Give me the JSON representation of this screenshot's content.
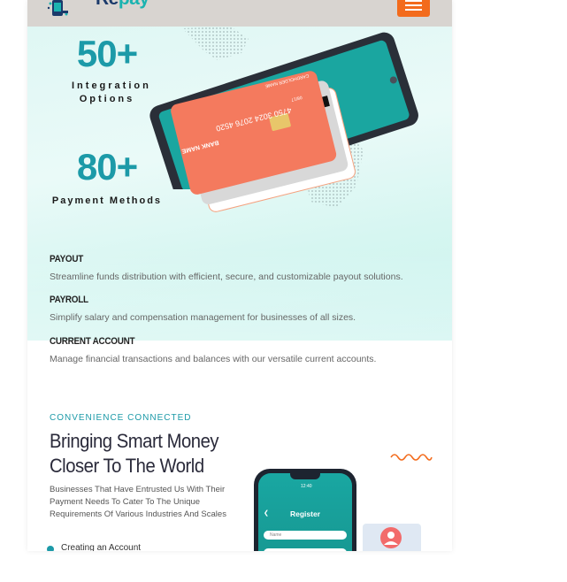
{
  "header": {
    "logo_text_a": "Re",
    "logo_text_b": "pay",
    "menu_icon": "hamburger-icon",
    "menu_color": "#f36b1c"
  },
  "hero": {
    "stats": [
      {
        "value": "50+",
        "label_line1": "Integration",
        "label_line2": "Options"
      },
      {
        "value": "80+",
        "label_line1": "Payment Methods",
        "label_line2": ""
      }
    ],
    "card": {
      "bank_name": "BANK NAME",
      "number": "4750 3024 2076 4520",
      "holder": "CARDHOLDER NAME",
      "expiry": "08/17"
    }
  },
  "services": [
    {
      "title": "PAYOUT",
      "description": "Streamline funds distribution with efficient, secure, and customizable payout solutions."
    },
    {
      "title": "PAYROLL",
      "description": "Simplify salary and compensation management for businesses of all sizes."
    },
    {
      "title": "CURRENT ACCOUNT",
      "description": "Manage financial transactions and balances with our versatile current accounts."
    }
  ],
  "promo": {
    "eyebrow": "CONVENIENCE CONNECTED",
    "headline_line1": "Bringing Smart Money",
    "headline_line2": "Closer To The World",
    "body": "Businesses That Have Entrusted Us With Their Payment Needs To Cater To The Unique Requirements Of Various Industries And Scales",
    "bullet_1": "Creating an Account"
  },
  "phone": {
    "time": "12:40",
    "title": "Register",
    "field_placeholder": "Name"
  },
  "colors": {
    "accent": "#1c9aa8",
    "brand_orange": "#f36b1c",
    "card": "#f47a5e"
  }
}
